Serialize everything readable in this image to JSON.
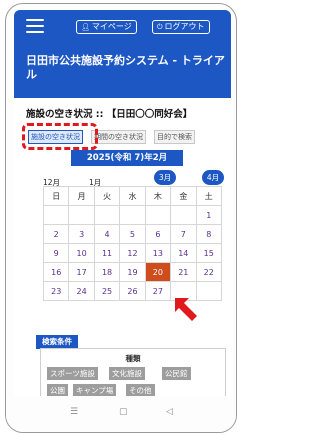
{
  "header": {
    "mypage_label": "マイページ",
    "logout_label": "ログアウト",
    "app_title": "日田市公共施設予約システム - トライアル"
  },
  "availability": {
    "title": "施設の空き状況 :: 【日田〇〇同好会】",
    "tabs": [
      "施設の空き状況",
      "期間の空き状況",
      "目的で検索"
    ]
  },
  "calendar": {
    "month_title": "2025(令和 7)年2月",
    "prev_badge": "3月",
    "next_badge": "4月",
    "prev_month_label": "12月",
    "current_month_label": "1月",
    "weekdays": [
      "日",
      "月",
      "火",
      "水",
      "木",
      "金",
      "土"
    ],
    "weeks": [
      [
        "",
        "",
        "",
        "",
        "",
        "",
        "1"
      ],
      [
        "2",
        "3",
        "4",
        "5",
        "6",
        "7",
        "8"
      ],
      [
        "9",
        "10",
        "11",
        "12",
        "13",
        "14",
        "15"
      ],
      [
        "16",
        "17",
        "18",
        "19",
        "20",
        "21",
        "22"
      ],
      [
        "23",
        "24",
        "25",
        "26",
        "27",
        "",
        ""
      ]
    ],
    "selected_day": "20"
  },
  "search": {
    "button_label": "検索条件",
    "panel_heading": "種類",
    "chips": [
      "スポーツ施設",
      "文化施設",
      "公民館",
      "公園",
      "キャンプ場",
      "その他"
    ]
  },
  "colors": {
    "primary": "#1d57c4",
    "selected": "#cf4c1c",
    "highlight": "#e0191f"
  },
  "android_nav": {
    "icons": [
      "menu-icon",
      "home-icon",
      "back-icon"
    ]
  }
}
